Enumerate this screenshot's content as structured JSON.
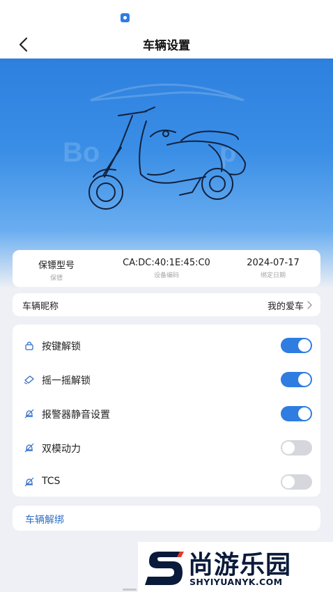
{
  "header": {
    "title": "车辆设置",
    "back_icon": "chevron-left-icon"
  },
  "hero": {
    "watermark_text": "Bo    p"
  },
  "device_info": [
    {
      "value": "保镖型号",
      "label": "保镖"
    },
    {
      "value": "CA:DC:40:1E:45:C0",
      "label": "设备编码"
    },
    {
      "value": "2024-07-17",
      "label": "绑定日期"
    }
  ],
  "nickname": {
    "label": "车辆昵称",
    "value": "我的爱车"
  },
  "settings": [
    {
      "label": "按键解锁",
      "icon": "lock-icon",
      "enabled": true
    },
    {
      "label": "摇一摇解锁",
      "icon": "shake-icon",
      "enabled": true
    },
    {
      "label": "报警器静音设置",
      "icon": "mute-bell-icon",
      "enabled": true
    },
    {
      "label": "双模动力",
      "icon": "mute-bell-icon",
      "enabled": false
    },
    {
      "label": "TCS",
      "icon": "mute-bell-icon",
      "enabled": false
    }
  ],
  "unbind": {
    "label": "车辆解绑"
  },
  "watermark": {
    "brand": "尚游乐园",
    "url": "SHYIYUANYK.COM"
  },
  "colors": {
    "accent": "#2f7de1",
    "toggle_off": "#d5d7dc",
    "hero_top": "#2d80de",
    "page_bg": "#eef0f5"
  }
}
